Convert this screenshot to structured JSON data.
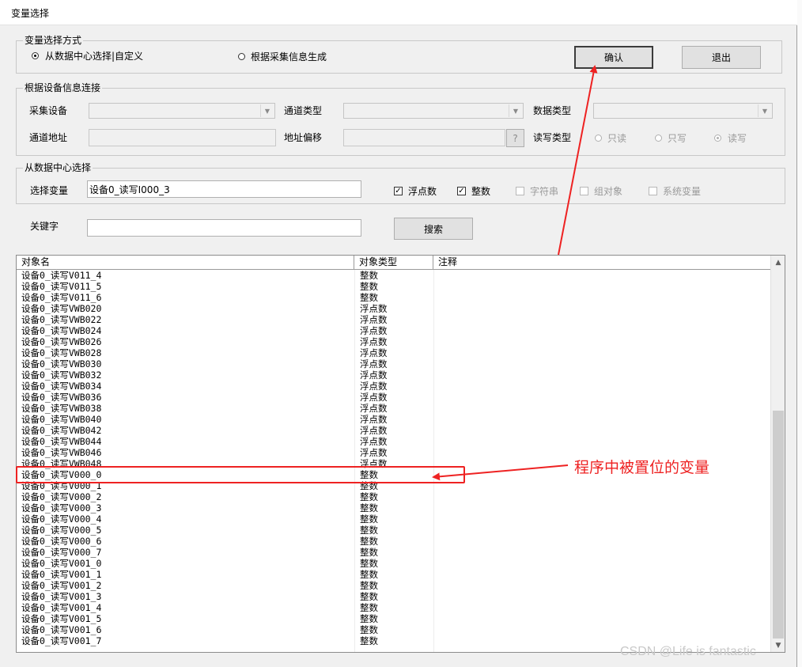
{
  "window": {
    "title": "变量选择"
  },
  "mode_group": {
    "legend": "变量选择方式",
    "option_datacenter": "从数据中心选择|自定义",
    "option_collect": "根据采集信息生成",
    "confirm_label": "确认",
    "exit_label": "退出"
  },
  "device_group": {
    "legend": "根据设备信息连接",
    "collect_device_label": "采集设备",
    "channel_type_label": "通道类型",
    "data_type_label": "数据类型",
    "channel_address_label": "通道地址",
    "address_offset_label": "地址偏移",
    "offset_button": "?",
    "rw_type_label": "读写类型",
    "rw_read_only": "只读",
    "rw_write_only": "只写",
    "rw_read_write": "读写"
  },
  "datacenter_group": {
    "legend": "从数据中心选择",
    "select_var_label": "选择变量",
    "select_var_value": "设备0_读写I000_3",
    "filters": {
      "float": "浮点数",
      "integer": "整数",
      "string": "字符串",
      "group_object": "组对象",
      "system_var": "系统变量"
    }
  },
  "search": {
    "keyword_label": "关键字",
    "keyword_value": "",
    "search_button": "搜索"
  },
  "list": {
    "columns": [
      "对象名",
      "对象类型",
      "注释"
    ],
    "rows": [
      {
        "name": "设备0_读写V011_4",
        "type": "整数"
      },
      {
        "name": "设备0_读写V011_5",
        "type": "整数"
      },
      {
        "name": "设备0_读写V011_6",
        "type": "整数"
      },
      {
        "name": "设备0_读写VWB020",
        "type": "浮点数"
      },
      {
        "name": "设备0_读写VWB022",
        "type": "浮点数"
      },
      {
        "name": "设备0_读写VWB024",
        "type": "浮点数"
      },
      {
        "name": "设备0_读写VWB026",
        "type": "浮点数"
      },
      {
        "name": "设备0_读写VWB028",
        "type": "浮点数"
      },
      {
        "name": "设备0_读写VWB030",
        "type": "浮点数"
      },
      {
        "name": "设备0_读写VWB032",
        "type": "浮点数"
      },
      {
        "name": "设备0_读写VWB034",
        "type": "浮点数"
      },
      {
        "name": "设备0_读写VWB036",
        "type": "浮点数"
      },
      {
        "name": "设备0_读写VWB038",
        "type": "浮点数"
      },
      {
        "name": "设备0_读写VWB040",
        "type": "浮点数"
      },
      {
        "name": "设备0_读写VWB042",
        "type": "浮点数"
      },
      {
        "name": "设备0_读写VWB044",
        "type": "浮点数"
      },
      {
        "name": "设备0_读写VWB046",
        "type": "浮点数"
      },
      {
        "name": "设备0_读写VWB048",
        "type": "浮点数"
      },
      {
        "name": "设备0_读写V000_0",
        "type": "整数"
      },
      {
        "name": "设备0_读写V000_1",
        "type": "整数"
      },
      {
        "name": "设备0_读写V000_2",
        "type": "整数"
      },
      {
        "name": "设备0_读写V000_3",
        "type": "整数"
      },
      {
        "name": "设备0_读写V000_4",
        "type": "整数"
      },
      {
        "name": "设备0_读写V000_5",
        "type": "整数"
      },
      {
        "name": "设备0_读写V000_6",
        "type": "整数"
      },
      {
        "name": "设备0_读写V000_7",
        "type": "整数"
      },
      {
        "name": "设备0_读写V001_0",
        "type": "整数"
      },
      {
        "name": "设备0_读写V001_1",
        "type": "整数"
      },
      {
        "name": "设备0_读写V001_2",
        "type": "整数"
      },
      {
        "name": "设备0_读写V001_3",
        "type": "整数"
      },
      {
        "name": "设备0_读写V001_4",
        "type": "整数"
      },
      {
        "name": "设备0_读写V001_5",
        "type": "整数"
      },
      {
        "name": "设备0_读写V001_6",
        "type": "整数"
      },
      {
        "name": "设备0_读写V001_7",
        "type": "整数"
      }
    ]
  },
  "annotation": {
    "text": "程序中被置位的变量",
    "color": "#ee2222"
  },
  "watermark": "CSDN @Life is fantastic",
  "scroll": {
    "up_icon": "▲",
    "down_icon": "▼"
  }
}
